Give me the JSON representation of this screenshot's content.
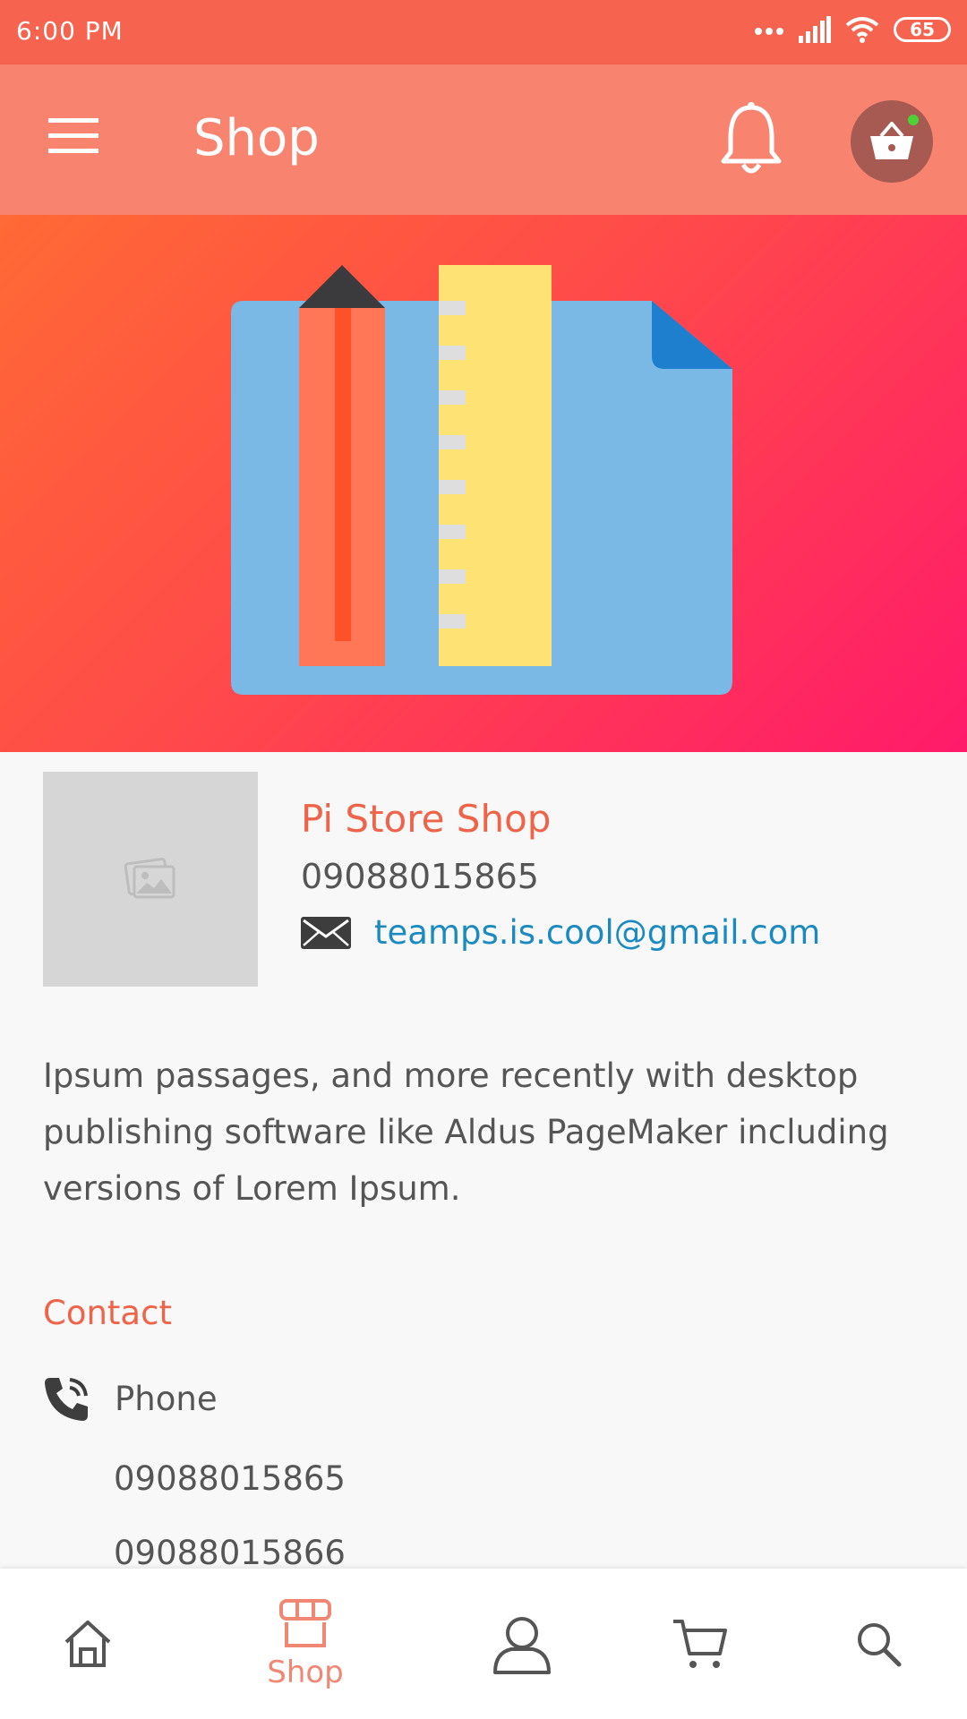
{
  "status_bar": {
    "time": "6:00 PM",
    "battery": "65"
  },
  "app_bar": {
    "title": "Shop"
  },
  "store": {
    "name": "Pi Store Shop",
    "phone": "09088015865",
    "email": "teamps.is.cool@gmail.com",
    "description": "Ipsum passages, and more recently with desktop publishing software like Aldus PageMaker including versions of Lorem Ipsum."
  },
  "contact": {
    "title": "Contact",
    "phone_label": "Phone",
    "numbers": [
      "09088015865",
      "09088015866"
    ]
  },
  "bottom_nav": {
    "items": [
      {
        "icon": "home-icon"
      },
      {
        "icon": "shop-icon",
        "label": "Shop",
        "active": true
      },
      {
        "icon": "profile-icon"
      },
      {
        "icon": "cart-icon"
      },
      {
        "icon": "search-icon"
      }
    ]
  },
  "colors": {
    "status_bar": "#f6634f",
    "app_bar": "#f8836f",
    "accent": "#ef6349",
    "link": "#1b8ac0",
    "hero_gradient": [
      "#ff6a35",
      "#ff4a4a",
      "#ff1a6a"
    ]
  }
}
